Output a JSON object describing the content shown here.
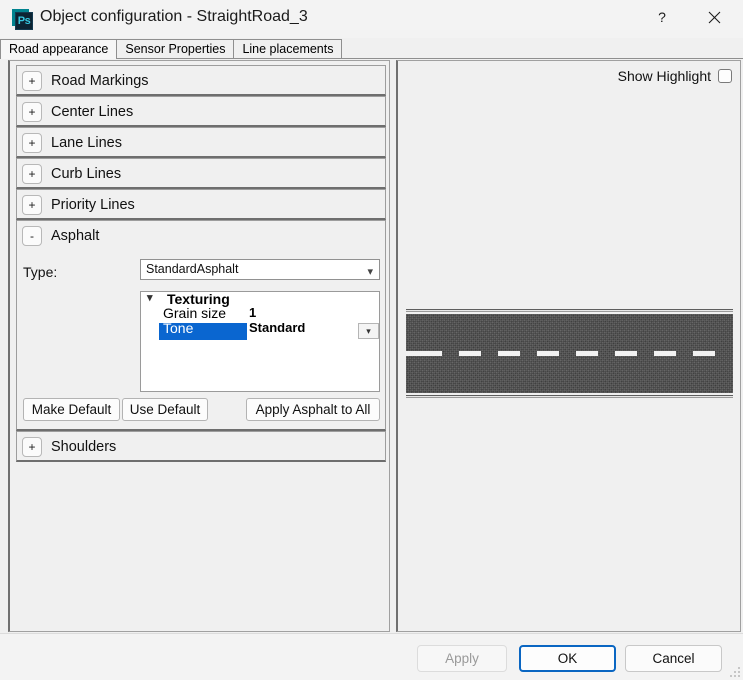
{
  "window": {
    "title": "Object configuration - StraightRoad_3",
    "icon": "photoshop-ps-icon",
    "icon_letters": "Ps",
    "help_label": "?",
    "close_label": "✕"
  },
  "tabs": [
    {
      "label": "Road appearance",
      "active": true
    },
    {
      "label": "Sensor Properties",
      "active": false
    },
    {
      "label": "Line placements",
      "active": false
    }
  ],
  "left_panel": {
    "sections": [
      {
        "toggle": "+",
        "label": "Road Markings",
        "expanded": false
      },
      {
        "toggle": "+",
        "label": "Center Lines",
        "expanded": false
      },
      {
        "toggle": "+",
        "label": "Lane Lines",
        "expanded": false
      },
      {
        "toggle": "+",
        "label": "Curb Lines",
        "expanded": false
      },
      {
        "toggle": "+",
        "label": "Priority Lines",
        "expanded": false
      },
      {
        "toggle": "-",
        "label": "Asphalt",
        "expanded": true
      },
      {
        "toggle": "+",
        "label": "Shoulders",
        "expanded": false
      }
    ],
    "asphalt": {
      "type_label": "Type:",
      "type_value": "StandardAsphalt",
      "type_chevron": "chevron-down-icon",
      "property_grid": {
        "category": "Texturing",
        "category_chevron": "chevron-down-icon",
        "rows": [
          {
            "name": "Grain size",
            "value": "1",
            "selected": false,
            "has_editor": false
          },
          {
            "name": "Tone",
            "value": "Standard",
            "selected": true,
            "has_editor": true,
            "editor_icon": "chevron-down-icon"
          }
        ]
      },
      "buttons": {
        "make_default": "Make Default",
        "use_default": "Use Default",
        "apply_to_all": "Apply Asphalt to All"
      }
    }
  },
  "right_panel": {
    "show_highlight_label": "Show Highlight",
    "show_highlight_checked": false,
    "preview": {
      "name": "road-preview",
      "asphalt_color": "#4b4b4b",
      "marking_color": "#f2f2f2",
      "dash_count": 8
    }
  },
  "footer": {
    "apply": "Apply",
    "apply_enabled": false,
    "ok": "OK",
    "ok_focused": true,
    "cancel": "Cancel"
  },
  "colors": {
    "accent": "#0a66c2",
    "selection": "#0a66d0",
    "window_bg": "#f0f0f0",
    "titlebar_bg": "#f3f3f3"
  }
}
